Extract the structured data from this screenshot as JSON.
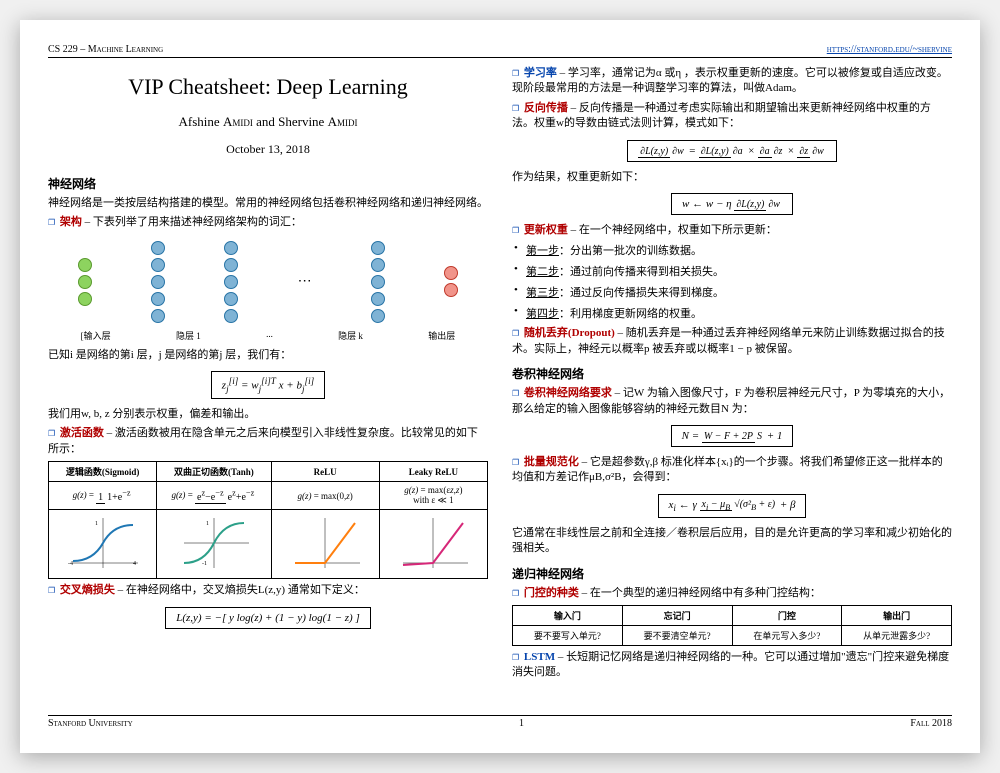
{
  "header": {
    "course": "CS 229 – Machine Learning",
    "url": "https://stanford.edu/~shervine"
  },
  "footer": {
    "left": "Stanford University",
    "page": "1",
    "right": "Fall 2018"
  },
  "meta": {
    "title": "VIP Cheatsheet: Deep Learning",
    "authors_html": "Afshine Amidi and Shervine Amidi",
    "a1_first": "Afshine ",
    "a1_last": "Amidi",
    "and": " and ",
    "a2_first": "Shervine ",
    "a2_last": "Amidi",
    "date": "October 13, 2018"
  },
  "sections": {
    "nn_title": "神经网络",
    "nn_intro": "神经网络是一类按层结构搭建的模型。常用的神经网络包括卷积神经网络和递归神经网络。",
    "arch_term": "架构",
    "arch_desc": " – 下表列举了用来描述神经网络架构的词汇：",
    "layers": {
      "input": "[输入层",
      "h1": "隐层 1",
      "dots": "...",
      "hk": "隐层 k",
      "output": "输出层"
    },
    "note_i": "已知i 是网络的第i 层，j 是网络的第j 层，我们有：",
    "eq_z": "zⱼ[i] = wⱼ[i]ᵀ x + bⱼ[i]",
    "note_wbz": "我们用w, b, z 分别表示权重，偏差和输出。",
    "activation_term": "激活函数",
    "activation_desc": " – 激活函数被用在隐含单元之后来向模型引入非线性复杂度。比较常见的如下所示：",
    "act_table": {
      "h1": "逻辑函数(Sigmoid)",
      "h2": "双曲正切函数(Tanh)",
      "h3": "ReLU",
      "h4": "Leaky ReLU",
      "f1": "g(z) = 1/(1+e⁻ᶻ)",
      "f2": "g(z) = (eᶻ−e⁻ᶻ)/(eᶻ+e⁻ᶻ)",
      "f3": "g(z) = max(0,z)",
      "f4": "g(z) = max(εz,z)",
      "f4_sub": "with ε ≪ 1"
    },
    "ce_term": "交叉熵损失",
    "ce_desc": " – 在神经网络中，交叉熵损失L(z,y) 通常如下定义：",
    "ce_eq": "L(z,y) = −[ y log(z) + (1 − y) log(1 − z) ]",
    "lr_term": "学习率",
    "lr_desc": " – 学习率，通常记为α 或η ，表示权重更新的速度。它可以被修复或自适应改变。现阶段最常用的方法是一种调整学习率的算法，叫做Adam。",
    "bp_term": "反向传播",
    "bp_desc": " – 反向传播是一种通过考虑实际输出和期望输出来更新神经网络中权重的方法。权重w的导数由链式法则计算，模式如下：",
    "bp_eq": "∂L(z,y)/∂w = ∂L(z,y)/∂a × ∂a/∂z × ∂z/∂w",
    "bp_result": "作为结果，权重更新如下：",
    "bp_update": "w ← w − η ∂L(z,y)/∂w",
    "update_term": "更新权重",
    "update_desc": " – 在一个神经网络中，权重如下所示更新：",
    "steps": {
      "s1l": "第一步",
      "s1": "：分出第一批次的训练数据。",
      "s2l": "第二步",
      "s2": "：通过前向传播来得到相关损失。",
      "s3l": "第三步",
      "s3": "：通过反向传播损失来得到梯度。",
      "s4l": "第四步",
      "s4": "：利用梯度更新网络的权重。"
    },
    "dropout_term": "随机丢弃(Dropout)",
    "dropout_desc": " – 随机丢弃是一种通过丢弃神经网络单元来防止训练数据过拟合的技术。实际上，神经元以概率p 被丢弃或以概率1 − p 被保留。",
    "cnn_title": "卷积神经网络",
    "cnn_req_term": "卷积神经网络要求",
    "cnn_req_desc": " – 记W 为输入图像尺寸，F 为卷积层神经元尺寸，P 为零填充的大小，那么给定的输入图像能够容纳的神经元数目N 为：",
    "cnn_eq": "N = (W − F + 2P)/S + 1",
    "bn_term": "批量规范化",
    "bn_desc": " – 它是超参数γ,β 标准化样本{xᵢ}的一个步骤。将我们希望修正这一批样本的均值和方差记作μB,σ²B，会得到：",
    "bn_eq": "xᵢ ← γ (xᵢ − μB)/√(σ²B + ε) + β",
    "bn_note": "它通常在非线性层之前和全连接／卷积层后应用，目的是允许更高的学习率和减少初始化的强相关。",
    "rnn_title": "递归神经网络",
    "gates_term": "门控的种类",
    "gates_desc": " – 在一个典型的递归神经网络中有多种门控结构：",
    "gates": {
      "h1": "输入门",
      "h2": "忘记门",
      "h3": "门控",
      "h4": "输出门",
      "q1": "要不要写入单元?",
      "q2": "要不要清空单元?",
      "q3": "在单元写入多少?",
      "q4": "从单元泄露多少?"
    },
    "lstm_term": "LSTM",
    "lstm_desc": " – 长短期记忆网络是递归神经网络的一种。它可以通过增加\"遗忘\"门控来避免梯度消失问题。"
  }
}
